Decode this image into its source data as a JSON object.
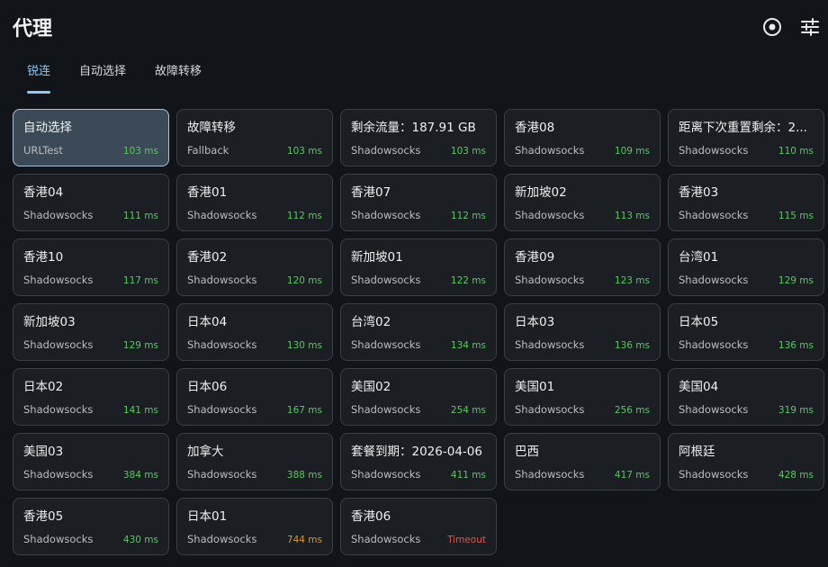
{
  "header": {
    "title": "代理"
  },
  "tabs": [
    {
      "label": "锐连",
      "active": true
    },
    {
      "label": "自动选择",
      "active": false
    },
    {
      "label": "故障转移",
      "active": false
    }
  ],
  "colors": {
    "accent": "#8ec8f6",
    "delay_good": "#58c95f",
    "delay_warn": "#d69a2d",
    "delay_timeout": "#e5534b"
  },
  "icons": {
    "target": "target-icon",
    "settings": "sliders-icon"
  },
  "proxies": [
    {
      "name": "自动选择",
      "type": "URLTest",
      "delay": "103 ms",
      "status": "good",
      "selected": true
    },
    {
      "name": "故障转移",
      "type": "Fallback",
      "delay": "103 ms",
      "status": "good"
    },
    {
      "name": "剩余流量：187.91 GB",
      "type": "Shadowsocks",
      "delay": "103 ms",
      "status": "good"
    },
    {
      "name": "香港08",
      "type": "Shadowsocks",
      "delay": "109 ms",
      "status": "good"
    },
    {
      "name": "距离下次重置剩余：2...",
      "type": "Shadowsocks",
      "delay": "110 ms",
      "status": "good"
    },
    {
      "name": "香港04",
      "type": "Shadowsocks",
      "delay": "111 ms",
      "status": "good"
    },
    {
      "name": "香港01",
      "type": "Shadowsocks",
      "delay": "112 ms",
      "status": "good"
    },
    {
      "name": "香港07",
      "type": "Shadowsocks",
      "delay": "112 ms",
      "status": "good"
    },
    {
      "name": "新加坡02",
      "type": "Shadowsocks",
      "delay": "113 ms",
      "status": "good"
    },
    {
      "name": "香港03",
      "type": "Shadowsocks",
      "delay": "115 ms",
      "status": "good"
    },
    {
      "name": "香港10",
      "type": "Shadowsocks",
      "delay": "117 ms",
      "status": "good"
    },
    {
      "name": "香港02",
      "type": "Shadowsocks",
      "delay": "120 ms",
      "status": "good"
    },
    {
      "name": "新加坡01",
      "type": "Shadowsocks",
      "delay": "122 ms",
      "status": "good"
    },
    {
      "name": "香港09",
      "type": "Shadowsocks",
      "delay": "123 ms",
      "status": "good"
    },
    {
      "name": "台湾01",
      "type": "Shadowsocks",
      "delay": "129 ms",
      "status": "good"
    },
    {
      "name": "新加坡03",
      "type": "Shadowsocks",
      "delay": "129 ms",
      "status": "good"
    },
    {
      "name": "日本04",
      "type": "Shadowsocks",
      "delay": "130 ms",
      "status": "good"
    },
    {
      "name": "台湾02",
      "type": "Shadowsocks",
      "delay": "134 ms",
      "status": "good"
    },
    {
      "name": "日本03",
      "type": "Shadowsocks",
      "delay": "136 ms",
      "status": "good"
    },
    {
      "name": "日本05",
      "type": "Shadowsocks",
      "delay": "136 ms",
      "status": "good"
    },
    {
      "name": "日本02",
      "type": "Shadowsocks",
      "delay": "141 ms",
      "status": "good"
    },
    {
      "name": "日本06",
      "type": "Shadowsocks",
      "delay": "167 ms",
      "status": "good"
    },
    {
      "name": "美国02",
      "type": "Shadowsocks",
      "delay": "254 ms",
      "status": "good"
    },
    {
      "name": "美国01",
      "type": "Shadowsocks",
      "delay": "256 ms",
      "status": "good"
    },
    {
      "name": "美国04",
      "type": "Shadowsocks",
      "delay": "319 ms",
      "status": "good"
    },
    {
      "name": "美国03",
      "type": "Shadowsocks",
      "delay": "384 ms",
      "status": "good"
    },
    {
      "name": "加拿大",
      "type": "Shadowsocks",
      "delay": "388 ms",
      "status": "good"
    },
    {
      "name": "套餐到期：2026-04-06",
      "type": "Shadowsocks",
      "delay": "411 ms",
      "status": "good"
    },
    {
      "name": "巴西",
      "type": "Shadowsocks",
      "delay": "417 ms",
      "status": "good"
    },
    {
      "name": "阿根廷",
      "type": "Shadowsocks",
      "delay": "428 ms",
      "status": "good"
    },
    {
      "name": "香港05",
      "type": "Shadowsocks",
      "delay": "430 ms",
      "status": "good"
    },
    {
      "name": "日本01",
      "type": "Shadowsocks",
      "delay": "744 ms",
      "status": "warn"
    },
    {
      "name": "香港06",
      "type": "Shadowsocks",
      "delay": "Timeout",
      "status": "bad"
    }
  ]
}
